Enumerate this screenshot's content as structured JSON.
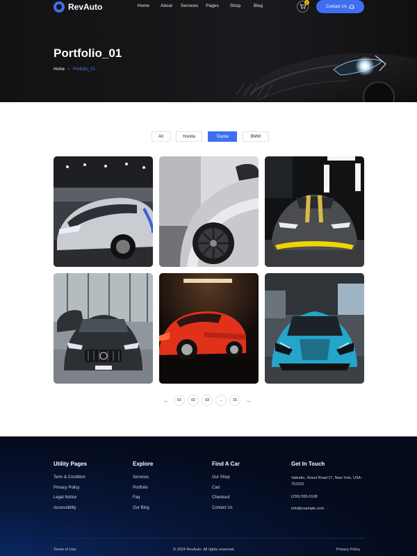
{
  "brand": {
    "name": "RevAuto",
    "accent": "#3f6ff1"
  },
  "nav": {
    "items": [
      "Home",
      "About",
      "Services",
      "Pages",
      "Shop",
      "Blog"
    ],
    "cart_count": "0",
    "contact_label": "Contact Us"
  },
  "hero": {
    "title": "Portfolio_01",
    "breadcrumb": {
      "home": "Home",
      "current": "Portfolio_01"
    }
  },
  "filters": {
    "items": [
      "All",
      "Honda",
      "Toyota",
      "BMW"
    ],
    "active": "Toyota"
  },
  "gallery": {
    "items": [
      {
        "icon": "car-photo-silver-supercar"
      },
      {
        "icon": "car-photo-silver-wheel"
      },
      {
        "icon": "car-photo-grey-yellow-supercar"
      },
      {
        "icon": "car-photo-black-mercedes"
      },
      {
        "icon": "car-photo-red-ferrari"
      },
      {
        "icon": "car-photo-blue-mclaren"
      }
    ]
  },
  "pagination": {
    "pages": [
      "01",
      "02",
      "03",
      "...",
      "15"
    ]
  },
  "footer": {
    "utility": {
      "title": "Utility Pages",
      "links": [
        "Term & Condition",
        "Privacy Policy",
        "Legal Notice",
        "Accessibility"
      ]
    },
    "explore": {
      "title": "Explore",
      "links": [
        "Services",
        "Portfolio",
        "Faq",
        "Our Blog"
      ]
    },
    "find": {
      "title": "Find A Car",
      "links": [
        "Our Shop",
        "Cart",
        "Checkout",
        "Contact Us"
      ]
    },
    "contact": {
      "title": "Get In Touch",
      "address": "Valentin, Street Road 27, New York, USA - 752252",
      "phone": "(239) 555-0108",
      "email": "info@example.com"
    },
    "terms": "Terms of Use",
    "copyright": "© 2024 RevAuto. All rights reserved.",
    "privacy": "Privacy Policy"
  }
}
